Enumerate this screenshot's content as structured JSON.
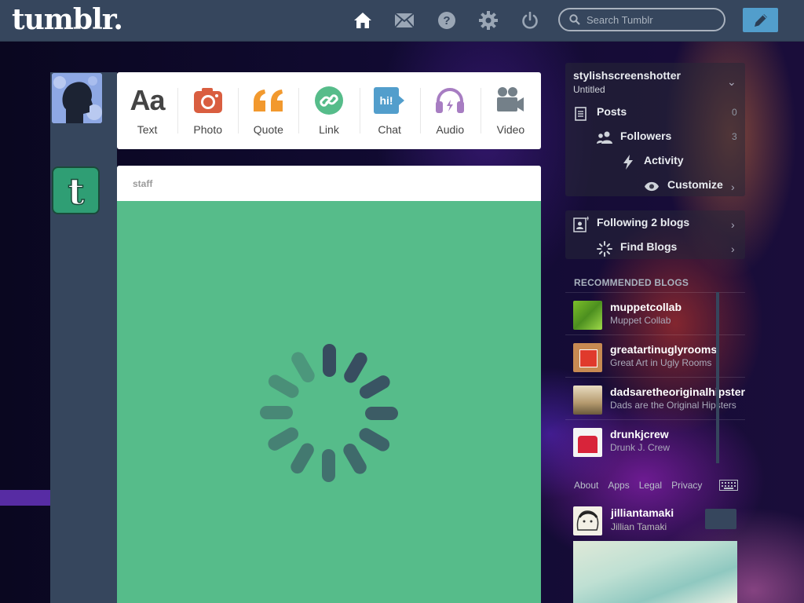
{
  "header": {
    "logo": "tumblr.",
    "nav_icons": [
      "home-icon",
      "mail-icon",
      "help-icon",
      "gear-icon",
      "power-icon"
    ],
    "search_placeholder": "Search Tumblr",
    "compose_icon": "pencil-icon",
    "accent": "#529ecc",
    "bar_color": "#36465d"
  },
  "post_types": [
    {
      "label": "Text",
      "icon": "text-icon",
      "color": "#444444"
    },
    {
      "label": "Photo",
      "icon": "camera-icon",
      "color": "#d95e40"
    },
    {
      "label": "Quote",
      "icon": "quote-icon",
      "color": "#f2992e"
    },
    {
      "label": "Link",
      "icon": "link-icon",
      "color": "#56bc8a"
    },
    {
      "label": "Chat",
      "icon": "chat-icon",
      "color": "#529ecc"
    },
    {
      "label": "Audio",
      "icon": "headphones-icon",
      "color": "#a77dc2"
    },
    {
      "label": "Video",
      "icon": "video-camera-icon",
      "color": "#748089"
    }
  ],
  "post": {
    "author": "staff",
    "card_color": "#56bc8a"
  },
  "blog_menu": {
    "blog_name": "stylishscreenshotter",
    "blog_title": "Untitled",
    "items": [
      {
        "label": "Posts",
        "count": "0"
      },
      {
        "label": "Followers",
        "count": "3"
      },
      {
        "label": "Activity",
        "count": ""
      },
      {
        "label": "Customize",
        "count": ""
      }
    ]
  },
  "following": {
    "label": "Following 2 blogs",
    "find_label": "Find Blogs"
  },
  "recommended": {
    "title": "RECOMMENDED BLOGS",
    "blogs": [
      {
        "name": "muppetcollab",
        "title": "Muppet Collab"
      },
      {
        "name": "greatartinuglyrooms",
        "title": "Great Art in Ugly Rooms"
      },
      {
        "name": "dadsaretheoriginalhipster",
        "title": "Dads are the Original Hipsters"
      },
      {
        "name": "drunkjcrew",
        "title": "Drunk J. Crew"
      }
    ]
  },
  "footer": {
    "links": [
      "About",
      "Apps",
      "Legal",
      "Privacy"
    ]
  },
  "radar": {
    "name": "jilliantamaki",
    "title": "Jillian Tamaki"
  }
}
